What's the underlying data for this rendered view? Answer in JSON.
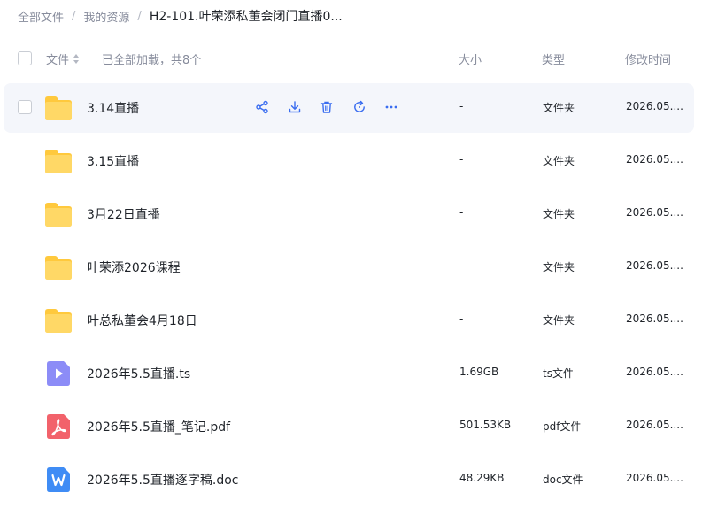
{
  "breadcrumb": {
    "items": [
      "全部文件",
      "我的资源"
    ],
    "current": "H2-101.叶荣添私董会闭门直播0...",
    "separator": "/"
  },
  "header": {
    "name_label": "文件",
    "loaded_text": "已全部加载，共8个",
    "size_label": "大小",
    "type_label": "类型",
    "modified_label": "修改时间"
  },
  "rows": [
    {
      "name": "3.14直播",
      "size": "-",
      "type": "文件夹",
      "modified": "2026.05....",
      "icon": "folder-icon"
    },
    {
      "name": "3.15直播",
      "size": "-",
      "type": "文件夹",
      "modified": "2026.05....",
      "icon": "folder-icon"
    },
    {
      "name": "3月22日直播",
      "size": "-",
      "type": "文件夹",
      "modified": "2026.05....",
      "icon": "folder-icon"
    },
    {
      "name": "叶荣添2026课程",
      "size": "-",
      "type": "文件夹",
      "modified": "2026.05....",
      "icon": "folder-icon"
    },
    {
      "name": "叶总私董会4月18日",
      "size": "-",
      "type": "文件夹",
      "modified": "2026.05....",
      "icon": "folder-icon"
    },
    {
      "name": "2026年5.5直播.ts",
      "size": "1.69GB",
      "type": "ts文件",
      "modified": "2026.05....",
      "icon": "video-file-icon"
    },
    {
      "name": "2026年5.5直播_笔记.pdf",
      "size": "501.53KB",
      "type": "pdf文件",
      "modified": "2026.05....",
      "icon": "pdf-file-icon"
    },
    {
      "name": "2026年5.5直播逐字稿.doc",
      "size": "48.29KB",
      "type": "doc文件",
      "modified": "2026.05....",
      "icon": "word-file-icon"
    }
  ],
  "row_actions": [
    "share-icon",
    "download-icon",
    "delete-icon",
    "restore-icon",
    "more-icon"
  ],
  "colors": {
    "accent": "#3a6df0",
    "folder": "#ffc93d",
    "video": "#8c8cf7",
    "pdf": "#f2626b",
    "word": "#3f8cf5",
    "hover_bg": "#f4f6fb"
  }
}
